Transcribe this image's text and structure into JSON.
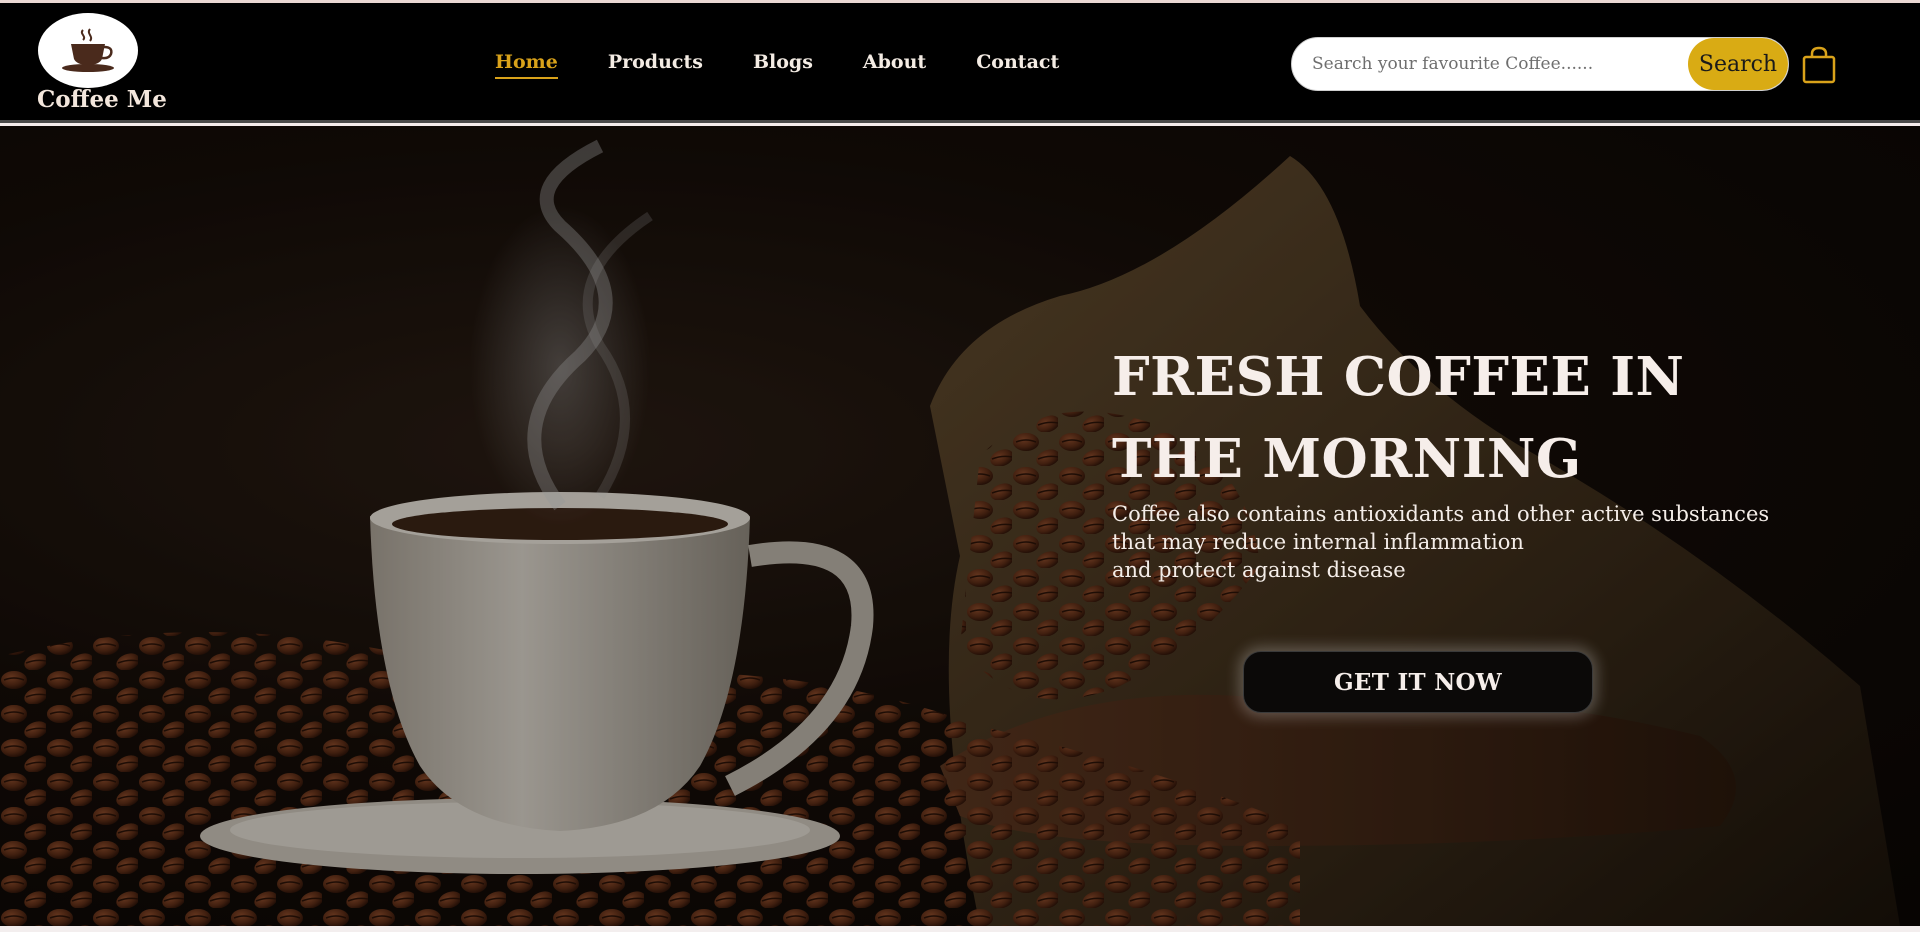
{
  "brand": {
    "name": "Coffee Me",
    "logo_icon": "coffee-cup-icon"
  },
  "nav": {
    "items": [
      {
        "label": "Home",
        "active": true
      },
      {
        "label": "Products",
        "active": false
      },
      {
        "label": "Blogs",
        "active": false
      },
      {
        "label": "About",
        "active": false
      },
      {
        "label": "Contact",
        "active": false
      }
    ]
  },
  "search": {
    "placeholder": "Search your favourite Coffee......",
    "value": "",
    "button_label": "Search"
  },
  "cart": {
    "icon": "shopping-bag-icon"
  },
  "hero": {
    "title_line1": "FRESH COFFEE IN",
    "title_line2": "THE MORNING",
    "desc_line1": "Coffee also contains antioxidants and other active substances",
    "desc_line2": "that may reduce internal inflammation",
    "desc_line3": "and protect against disease",
    "cta_label": "GET IT NOW"
  },
  "colors": {
    "header_bg": "#000000",
    "accent": "#d9a21a",
    "search_button": "#d9ab14",
    "nav_text": "#f4ece4"
  }
}
